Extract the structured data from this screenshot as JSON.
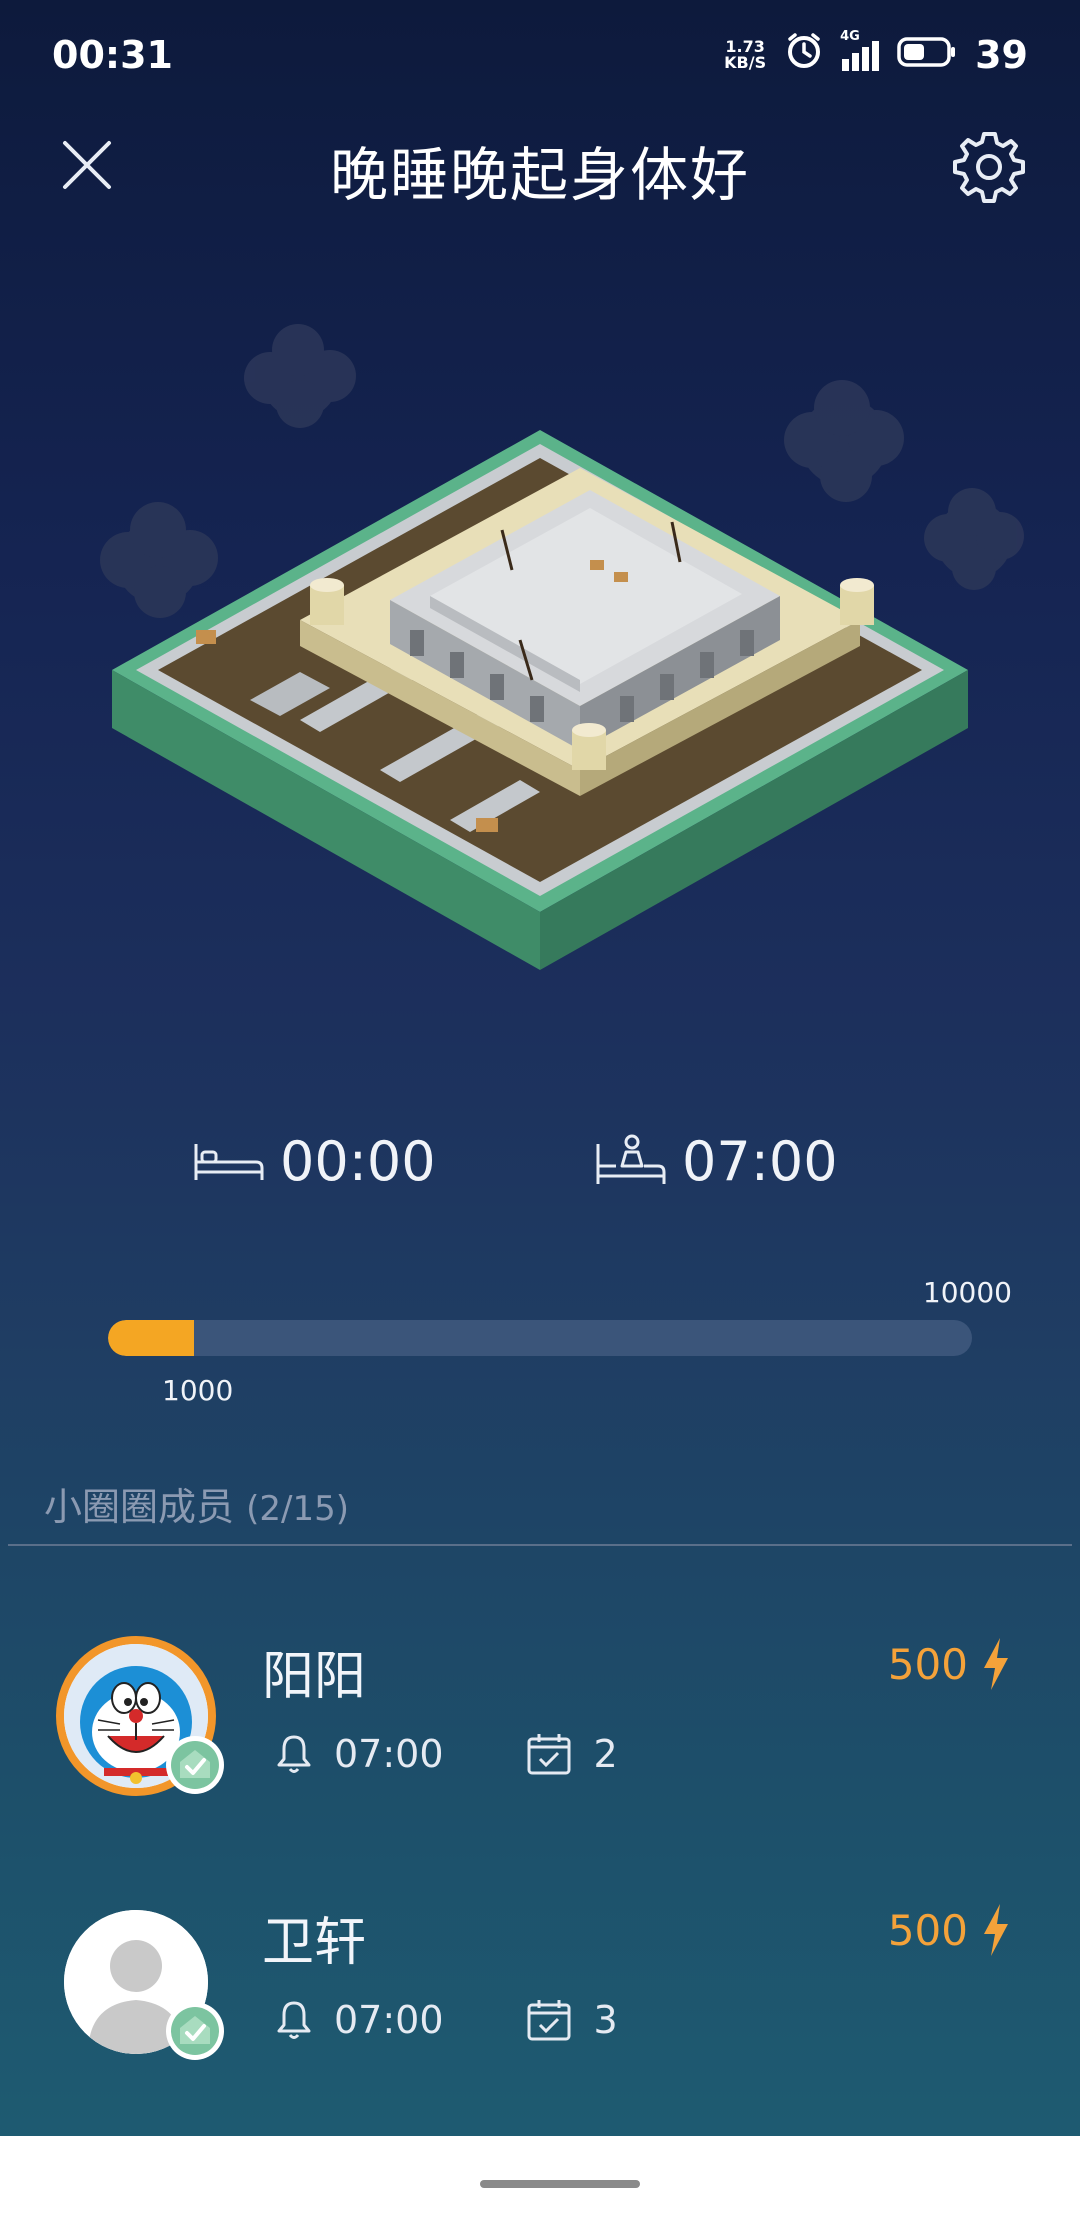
{
  "status_bar": {
    "time": "00:31",
    "net_speed_value": "1.73",
    "net_speed_unit": "KB/S",
    "signal_label": "4G",
    "battery": "39"
  },
  "header": {
    "title": "晚睡晚起身体好"
  },
  "schedule": {
    "bedtime": "00:00",
    "wake_time": "07:00"
  },
  "progress": {
    "current": "1000",
    "max": "10000",
    "fraction": 0.1
  },
  "members_section": {
    "label": "小圈圈成员",
    "count": "(2/15)"
  },
  "members": [
    {
      "name": "阳阳",
      "energy": "500",
      "alarm": "07:00",
      "days": "2",
      "avatar": "doraemon-avatar"
    },
    {
      "name": "卫轩",
      "energy": "500",
      "alarm": "07:00",
      "days": "3",
      "avatar": "default-person-avatar"
    }
  ],
  "colors": {
    "accent_orange": "#f4a623",
    "energy_orange": "#f4a23a",
    "badge_green": "#7cc4a0",
    "platform_green": "#4d9e78"
  }
}
